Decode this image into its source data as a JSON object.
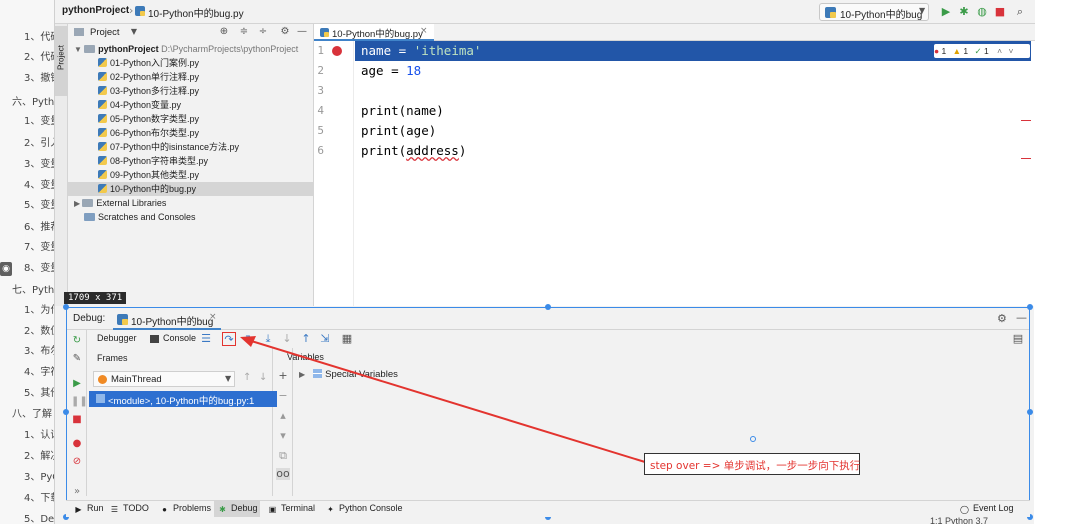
{
  "background_doc": {
    "lines": [
      "1、代码",
      "2、代码",
      "3、撤销",
      "六、Python",
      "1、变量",
      "2、引入",
      "3、变量",
      "4、变量",
      "5、变量",
      "6、推荐",
      "7、变量",
      "8、变量",
      "七、Python",
      "1、为什",
      "2、数值",
      "3、布尔",
      "4、字符",
      "5、其他",
      "八、了解",
      "1、认识",
      "2、解决",
      "3、PyC",
      "4、下载",
      "5、Deb"
    ]
  },
  "titlebar": {
    "project": "pythonProject",
    "file": "10-Python中的bug.py",
    "run_config": "10-Python中的bug"
  },
  "left_strip": {
    "project_tab": "Project"
  },
  "project_panel": {
    "header": "Project",
    "root_name": "pythonProject",
    "root_path": "D:\\PycharmProjects\\pythonProject",
    "files": [
      "01-Python入门案例.py",
      "02-Python单行注释.py",
      "03-Python多行注释.py",
      "04-Python变量.py",
      "05-Python数字类型.py",
      "06-Python布尔类型.py",
      "07-Python中的isinstance方法.py",
      "08-Python字符串类型.py",
      "09-Python其他类型.py",
      "10-Python中的bug.py"
    ],
    "external_libraries": "External Libraries",
    "scratches": "Scratches and Consoles"
  },
  "editor": {
    "tab": "10-Python中的bug.py",
    "line_numbers": [
      "1",
      "2",
      "3",
      "4",
      "5",
      "6"
    ],
    "code": {
      "l1_var": "name = ",
      "l1_str": "'itheima'",
      "l2_var": "age = ",
      "l2_num": "18",
      "l4": "print(name)",
      "l5": "print(age)",
      "l6_pre": "print(",
      "l6_err": "address",
      "l6_post": ")"
    },
    "inspection": {
      "errors": "1",
      "warnings": "1",
      "ok": "1"
    }
  },
  "overlay": {
    "size_tag": "1709 x 371"
  },
  "debug": {
    "label": "Debug:",
    "tab": "10-Python中的bug",
    "toolbar": {
      "debugger": "Debugger",
      "console": "Console"
    },
    "frames_title": "Frames",
    "thread": "MainThread",
    "frame": "<module>, 10-Python中的bug.py:1",
    "variables_title": "Variables",
    "special_variables": "Special Variables",
    "annotation": "step over => 单步调试，一步一步向下执行"
  },
  "bottom_bar": {
    "run": "Run",
    "todo": "TODO",
    "problems": "Problems",
    "debug": "Debug",
    "terminal": "Terminal",
    "python_console": "Python Console",
    "event_log": "Event Log"
  },
  "statusbar_tail": "1:1   Python 3.7",
  "colors": {
    "accent": "#3b8be8",
    "current_line": "#2256a8",
    "breakpoint": "#d8333b",
    "annotation_red": "#e3342f"
  }
}
